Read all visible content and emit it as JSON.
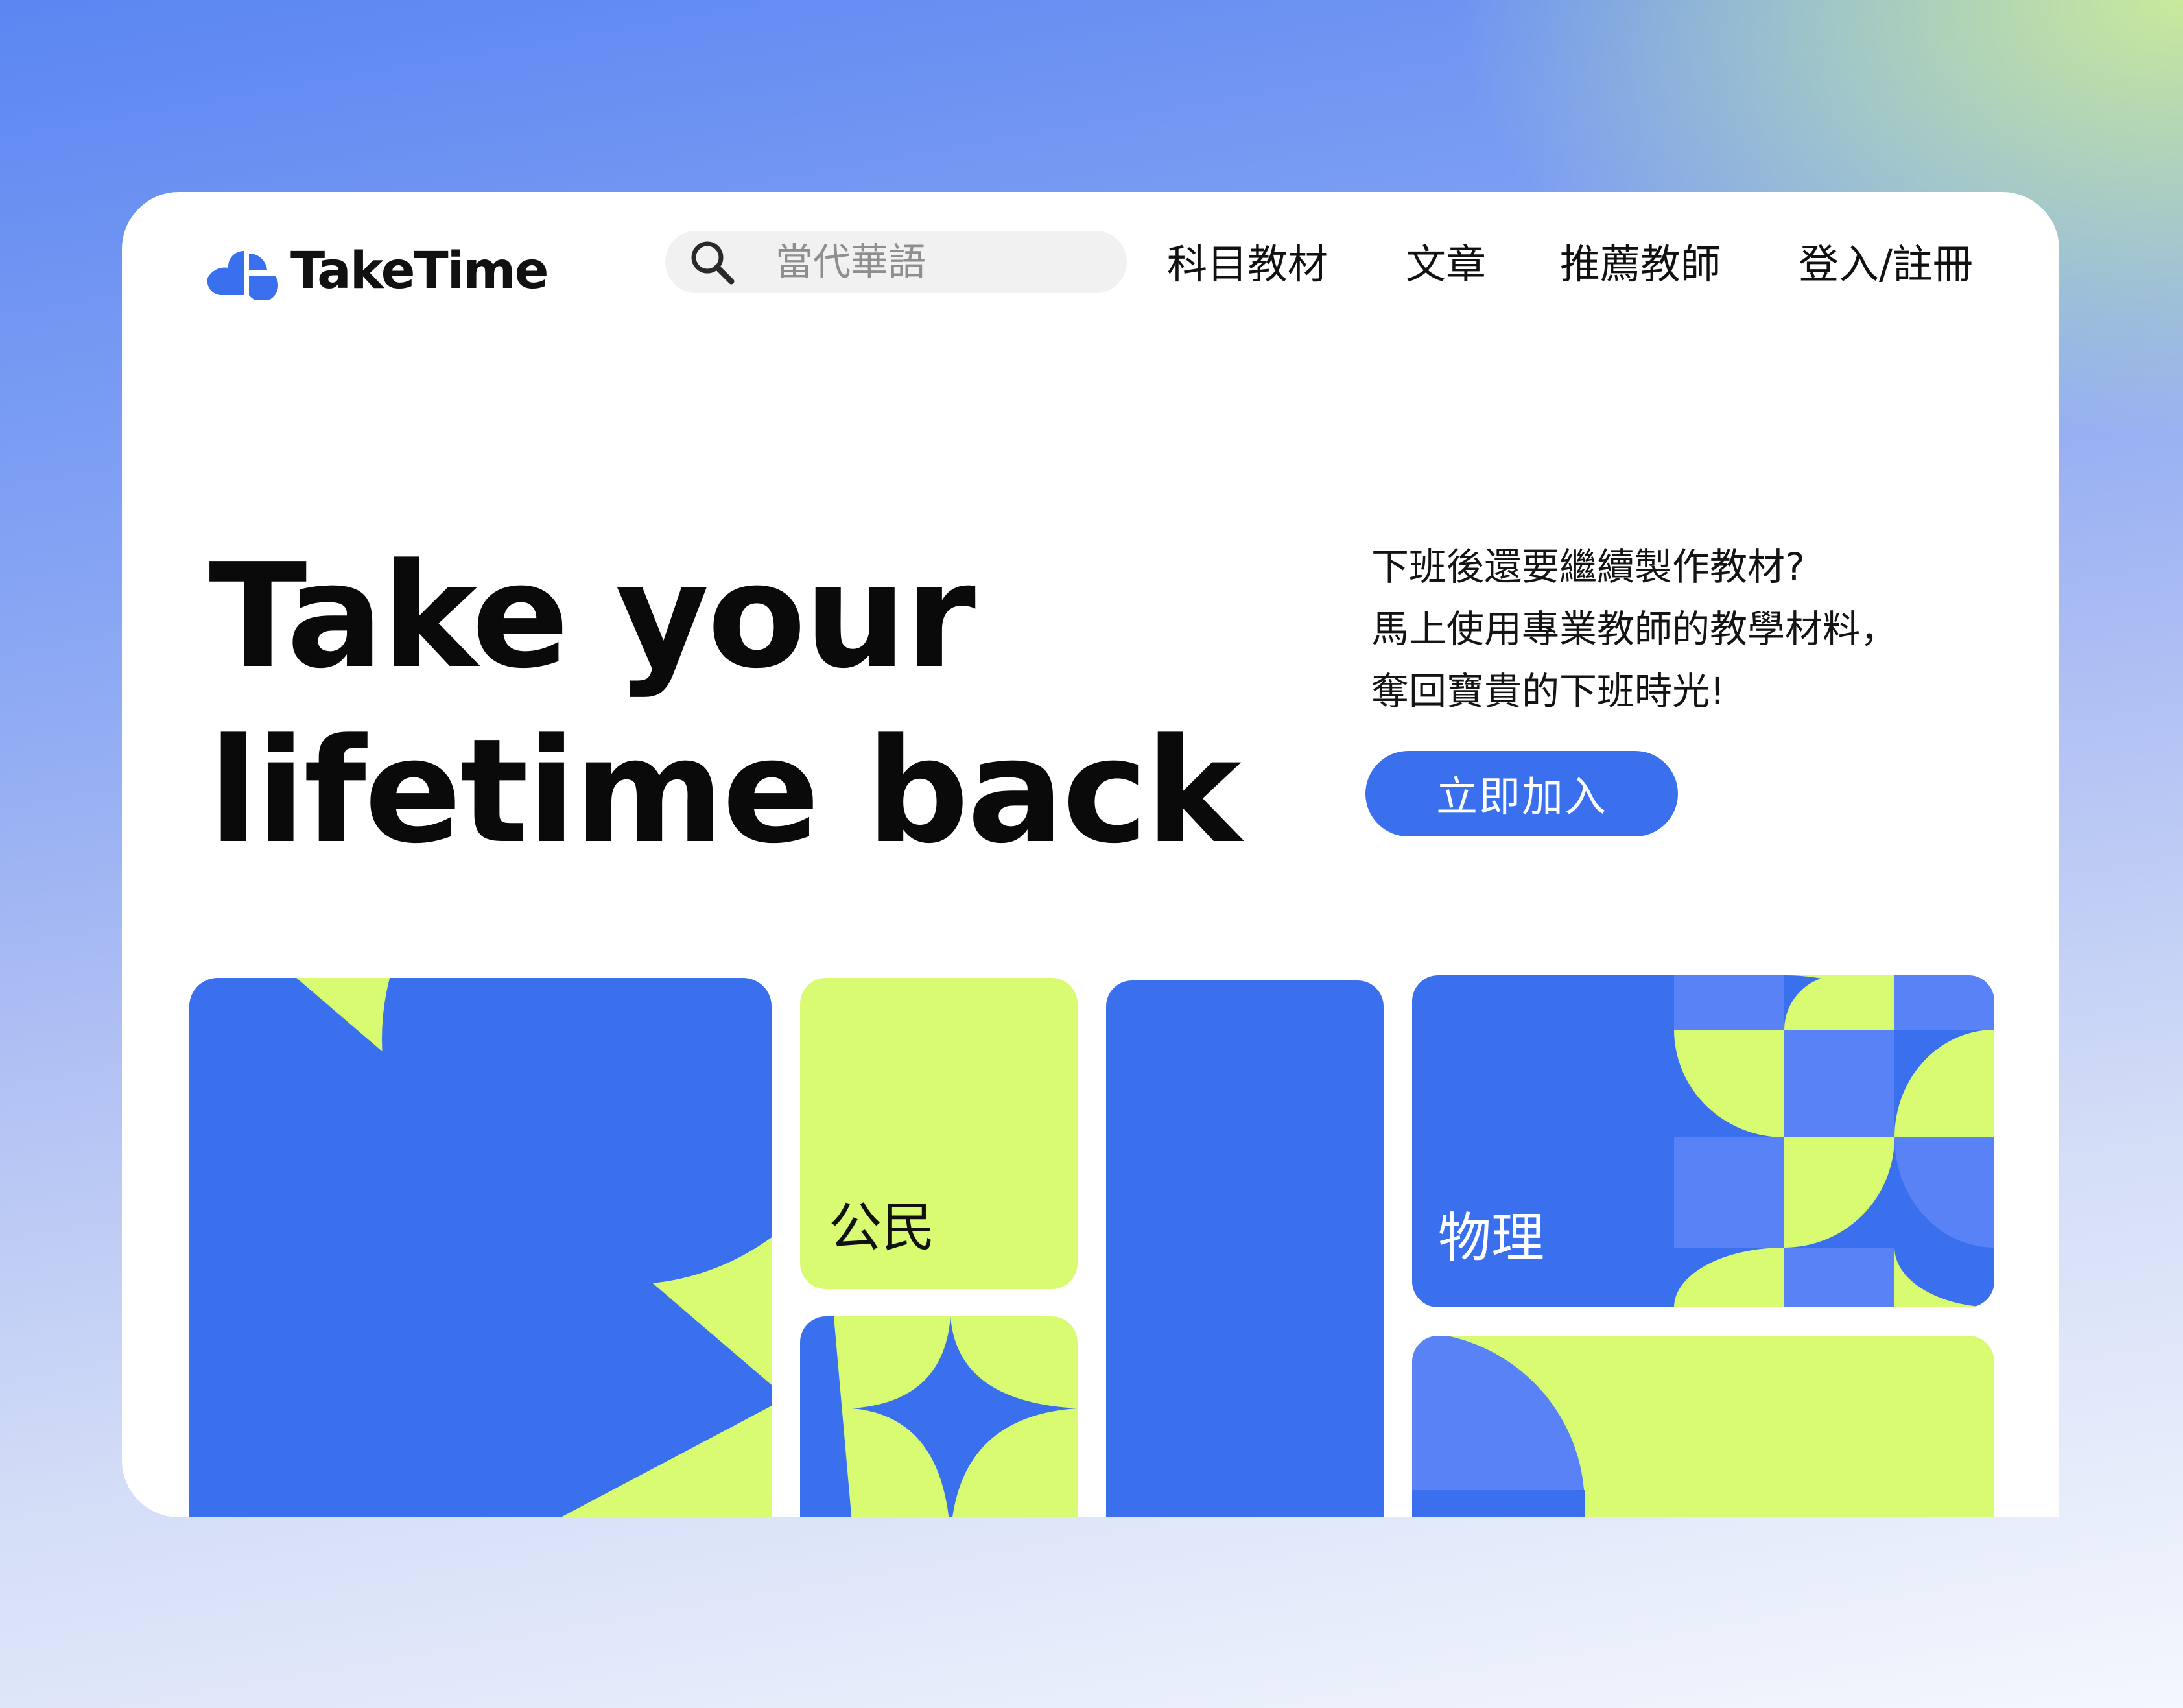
{
  "brand": {
    "name": "TakeTime"
  },
  "search": {
    "placeholder": "當代華語"
  },
  "nav": {
    "items": [
      "科目教材",
      "文章",
      "推薦教師",
      "登入/註冊"
    ]
  },
  "hero": {
    "title_line1": "Take your",
    "title_line2": "lifetime back",
    "desc_line1": "下班後還要繼續製作教材?",
    "desc_line2": "馬上使用專業教師的教學材料，",
    "desc_line3": "奪回寶貴的下班時光!",
    "cta_label": "立即加入"
  },
  "subjects": {
    "civics": "公民",
    "physics": "物理"
  },
  "colors": {
    "accent_blue": "#3a70ee",
    "accent_lime": "#d9fb72",
    "light_blue": "#5882f5",
    "text_dark": "#111111"
  },
  "icons": {
    "logo": "cloud-logo-icon",
    "search": "search-icon"
  }
}
